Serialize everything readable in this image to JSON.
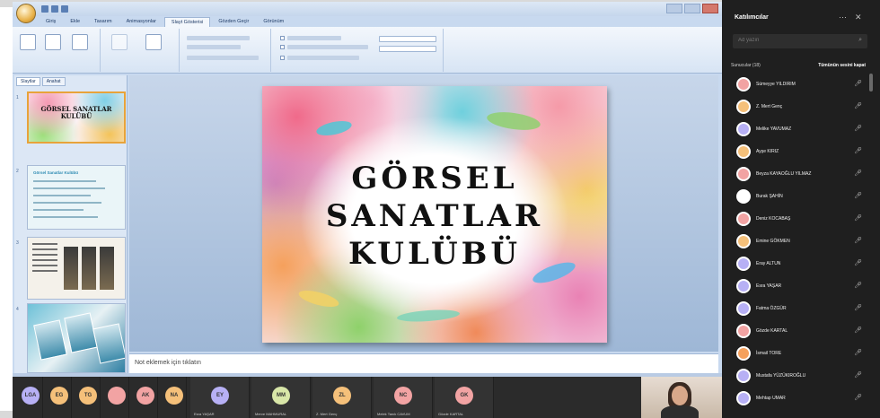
{
  "powerpoint": {
    "tabs": [
      "Giriş",
      "Ekle",
      "Tasarım",
      "Animasyonlar",
      "Slayt Gösterisi",
      "Gözden Geçir",
      "Görünüm"
    ],
    "pane_tabs": [
      "Slaytlar",
      "Anahat"
    ],
    "thumbnails": {
      "slide1_title": "GÖRSEL SANATLAR KULÜBÜ",
      "slide2_heading": "Görsel Sanatlar Kulübü"
    },
    "slide": {
      "title_lines": [
        "GÖRSEL",
        "SANATLAR",
        "KULÜBÜ"
      ]
    },
    "notes_placeholder": "Not eklemek için tıklatın"
  },
  "participants_panel": {
    "title": "Katılımcılar",
    "search_placeholder": "Ad yazın",
    "section_label": "Sunucular (18)",
    "mute_all": "Tümünün sesini kapat",
    "participants": [
      {
        "name": "Sümeyye YILDIRIM",
        "color": "#f2a3a3"
      },
      {
        "name": "Z. Mert Genç",
        "color": "#f5c07a"
      },
      {
        "name": "Melike YAVUMAZ",
        "color": "#b7b0f5"
      },
      {
        "name": "Ayşe KIRIZ",
        "color": "#f5c07a"
      },
      {
        "name": "Beyza KAYAOĞLU YILMAZ",
        "color": "#f2a3a3"
      },
      {
        "name": "Burak ŞAHİN",
        "color": "#ffffff"
      },
      {
        "name": "Deniz KOCABAŞ",
        "color": "#f2a3a3"
      },
      {
        "name": "Emine GÖKMEN",
        "color": "#f5c07a"
      },
      {
        "name": "Eray ALTUN",
        "color": "#b7b0f5"
      },
      {
        "name": "Esra YAŞAR",
        "color": "#b7b0f5"
      },
      {
        "name": "Fatma ÖZGÜR",
        "color": "#b7b0f5"
      },
      {
        "name": "Gözde KARTAL",
        "color": "#f2a3a3"
      },
      {
        "name": "İsmail TORE",
        "color": "#f5a05c"
      },
      {
        "name": "Mustafa YÜZÜKIROĞLU",
        "color": "#b7b0f5"
      },
      {
        "name": "Mehtap UMAR",
        "color": "#b7b0f5"
      }
    ]
  },
  "video_strip": {
    "tiles": [
      {
        "initials": "LGA",
        "color": "#b7b0f5",
        "name": ""
      },
      {
        "initials": "EG",
        "color": "#f5c07a",
        "name": ""
      },
      {
        "initials": "TG",
        "color": "#f5c07a",
        "name": ""
      },
      {
        "initials": "",
        "color": "#f2a3a3",
        "name": ""
      },
      {
        "initials": "AK",
        "color": "#f2a3a3",
        "name": ""
      },
      {
        "initials": "NA",
        "color": "#f5c07a",
        "name": ""
      },
      {
        "initials": "EY",
        "color": "#b7b0f5",
        "name": "Esra YAŞAR"
      },
      {
        "initials": "MM",
        "color": "#d8e6a8",
        "name": "Merve MAHMURAL"
      },
      {
        "initials": "ZL",
        "color": "#f5c07a",
        "name": "Z. Mert Genç"
      },
      {
        "initials": "NC",
        "color": "#f2a3a3",
        "name": "Melek Tanık CAVUM"
      },
      {
        "initials": "GK",
        "color": "#f2a3a3",
        "name": "Gözde KARTAL"
      }
    ]
  }
}
